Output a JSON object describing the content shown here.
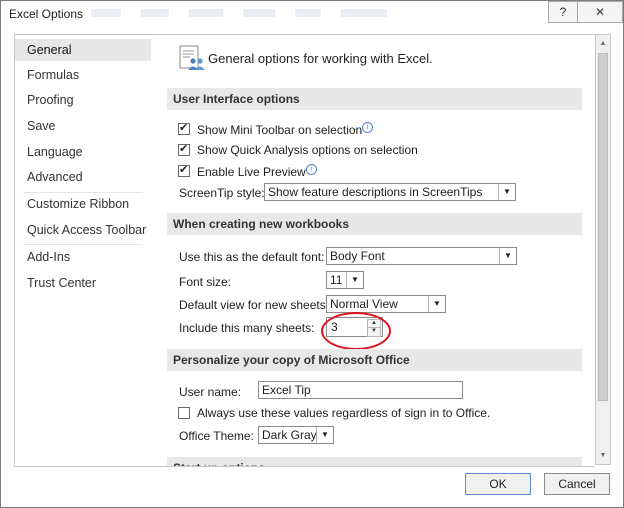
{
  "window": {
    "title": "Excel Options",
    "help_label": "?",
    "close_label": "✕"
  },
  "sidebar": {
    "items": [
      {
        "label": "General",
        "active": true
      },
      {
        "label": "Formulas"
      },
      {
        "label": "Proofing"
      },
      {
        "label": "Save"
      },
      {
        "label": "Language"
      },
      {
        "label": "Advanced"
      },
      {
        "label": "Customize Ribbon"
      },
      {
        "label": "Quick Access Toolbar"
      },
      {
        "label": "Add-Ins"
      },
      {
        "label": "Trust Center"
      }
    ]
  },
  "content": {
    "header": "General options for working with Excel.",
    "ui_section": {
      "title": "User Interface options",
      "show_mini_toolbar": "Show Mini Toolbar on selection",
      "show_quick_analysis": "Show Quick Analysis options on selection",
      "enable_live_preview": "Enable Live Preview",
      "screentip_label": "ScreenTip style:",
      "screentip_value": "Show feature descriptions in ScreenTips"
    },
    "workbook_section": {
      "title": "When creating new workbooks",
      "default_font_label": "Use this as the default font:",
      "default_font_value": "Body Font",
      "font_size_label": "Font size:",
      "font_size_value": "11",
      "default_view_label": "Default view for new sheets:",
      "default_view_value": "Normal View",
      "sheets_label": "Include this many sheets:",
      "sheets_value": "3"
    },
    "personalize_section": {
      "title": "Personalize your copy of Microsoft Office",
      "username_label": "User name:",
      "username_value": "Excel Tip",
      "always_use_label": "Always use these values regardless of sign in to Office.",
      "theme_label": "Office Theme:",
      "theme_value": "Dark Gray"
    },
    "startup_section": {
      "title": "Start up options"
    }
  },
  "buttons": {
    "ok": "OK",
    "cancel": "Cancel"
  },
  "colors": {
    "section_header_bg": "#e8e8e8",
    "highlight_circle": "#e0101a",
    "active_sidebar": "#e7e7e7"
  }
}
